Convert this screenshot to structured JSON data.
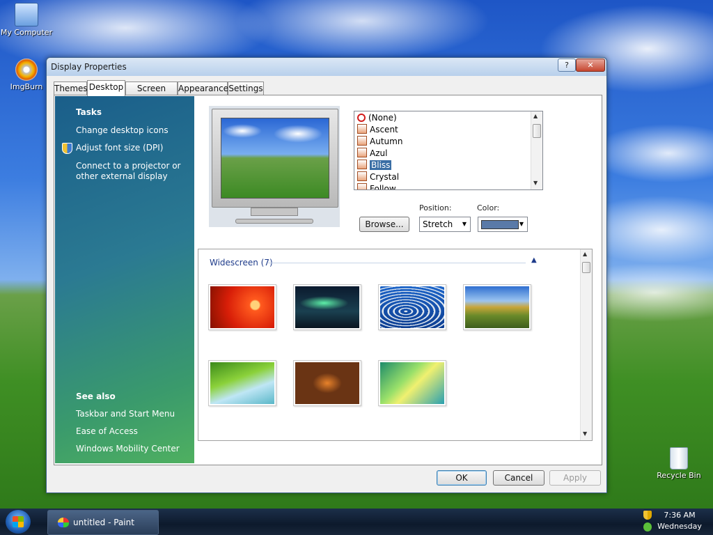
{
  "desktop": {
    "icons": [
      {
        "label": "My Computer",
        "icon": "computer-icon"
      },
      {
        "label": "ImgBurn",
        "icon": "disc-icon"
      },
      {
        "label": "Recycle Bin",
        "icon": "recycle-bin-icon"
      }
    ]
  },
  "window": {
    "title": "Display Properties",
    "help_label": "?",
    "close_label": "✕",
    "tabs": [
      {
        "label": "Themes"
      },
      {
        "label": "Desktop",
        "active": true
      },
      {
        "label": "Screen Saver"
      },
      {
        "label": "Appearance"
      },
      {
        "label": "Settings"
      }
    ]
  },
  "sidepane": {
    "tasks_heading": "Tasks",
    "tasks": [
      {
        "label": "Change desktop icons"
      },
      {
        "label": "Adjust font size (DPI)",
        "icon": "shield-icon"
      },
      {
        "label": "Connect to a projector or other external display"
      }
    ],
    "see_also_heading": "See also",
    "see_also": [
      {
        "label": "Taskbar and Start Menu"
      },
      {
        "label": "Ease of Access"
      },
      {
        "label": "Windows Mobility Center"
      }
    ]
  },
  "background_list": {
    "items": [
      {
        "label": "(None)",
        "icon": "none-icon"
      },
      {
        "label": "Ascent",
        "icon": "image-file-icon"
      },
      {
        "label": "Autumn",
        "icon": "image-file-icon"
      },
      {
        "label": "Azul",
        "icon": "image-file-icon"
      },
      {
        "label": "Bliss",
        "icon": "image-file-icon",
        "selected": true
      },
      {
        "label": "Crystal",
        "icon": "image-file-icon"
      },
      {
        "label": "Follow",
        "icon": "image-file-icon"
      }
    ]
  },
  "controls": {
    "browse_label": "Browse...",
    "position_label": "Position:",
    "position_value": "Stretch",
    "color_label": "Color:",
    "color_value": "#5a7aa8"
  },
  "gallery": {
    "heading": "Widescreen (7)",
    "collapse_icon": "▲",
    "thumbnails": [
      {
        "name": "red-flower"
      },
      {
        "name": "aurora"
      },
      {
        "name": "fish"
      },
      {
        "name": "landscape"
      },
      {
        "name": "palm-leaf"
      },
      {
        "name": "rock-formation"
      },
      {
        "name": "green-aurora"
      }
    ]
  },
  "dialog_buttons": {
    "ok": "OK",
    "cancel": "Cancel",
    "apply": "Apply"
  },
  "taskbar": {
    "task_label": "untitled - Paint",
    "time": "7:36 AM",
    "day": "Wednesday"
  }
}
